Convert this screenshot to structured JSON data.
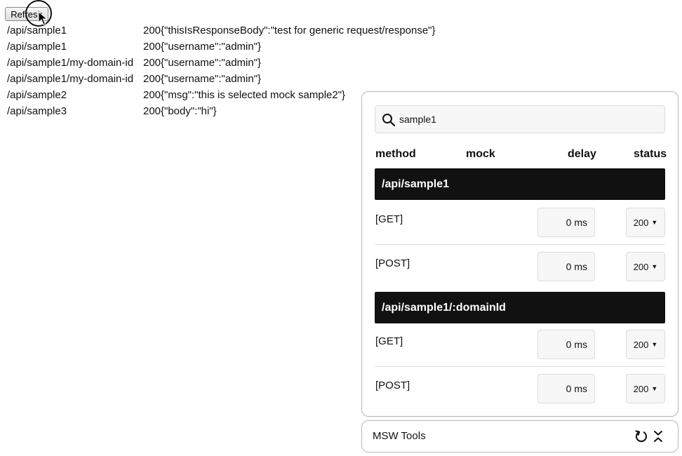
{
  "refresh_button": {
    "label": "Refresh"
  },
  "log": [
    {
      "path": "/api/sample1",
      "status": "200",
      "body": "{\"thisIsResponseBody\":\"test for generic request/response\"}"
    },
    {
      "path": "/api/sample1",
      "status": "200",
      "body": "{\"username\":\"admin\"}"
    },
    {
      "path": "/api/sample1/my-domain-id",
      "status": "200",
      "body": "{\"username\":\"admin\"}"
    },
    {
      "path": "/api/sample1/my-domain-id",
      "status": "200",
      "body": "{\"username\":\"admin\"}"
    },
    {
      "path": "/api/sample2",
      "status": "200",
      "body": "{\"msg\":\"this is selected mock sample2\"}"
    },
    {
      "path": "/api/sample3",
      "status": "200",
      "body": "{\"body\":\"hi\"}"
    }
  ],
  "panel": {
    "search": {
      "value": "sample1",
      "icon": "search-icon"
    },
    "columns": {
      "method": "method",
      "mock": "mock",
      "delay": "delay",
      "status": "status"
    },
    "groups": [
      {
        "path": "/api/sample1",
        "rows": [
          {
            "method": "[GET]",
            "delay": "0 ms",
            "status": "200"
          },
          {
            "method": "[POST]",
            "delay": "0 ms",
            "status": "200"
          }
        ]
      },
      {
        "path": "/api/sample1/:domainId",
        "rows": [
          {
            "method": "[GET]",
            "delay": "0 ms",
            "status": "200"
          },
          {
            "method": "[POST]",
            "delay": "0 ms",
            "status": "200"
          }
        ]
      }
    ]
  },
  "tools_bar": {
    "title": "MSW Tools",
    "icons": [
      "reset-icon",
      "collapse-icon"
    ]
  }
}
